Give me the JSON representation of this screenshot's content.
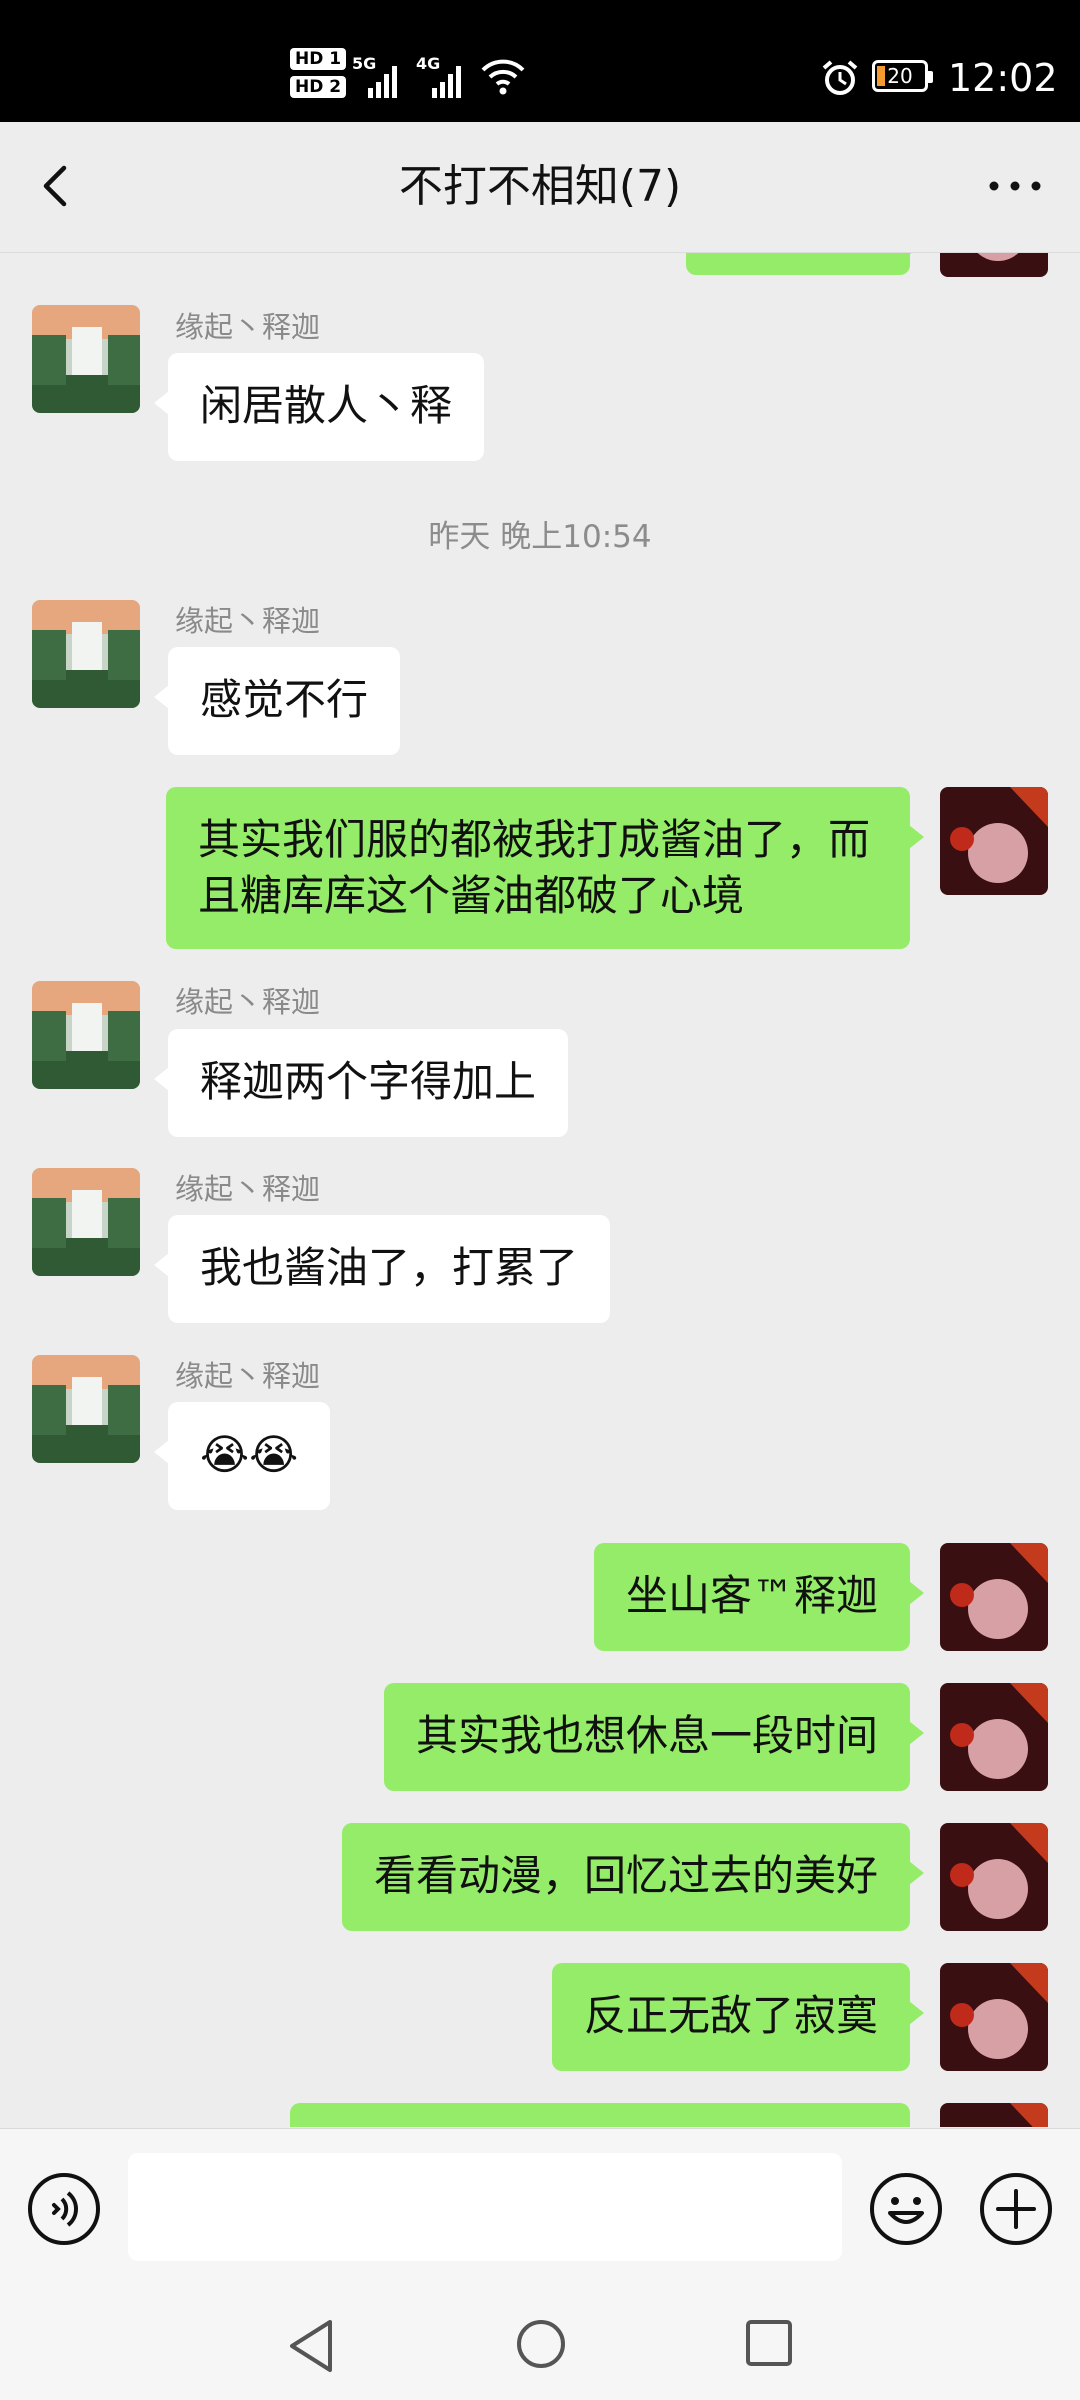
{
  "status_bar": {
    "hd1": "HD 1",
    "hd2": "HD 2",
    "net1": "5G",
    "net2": "4G",
    "battery": "20",
    "time": "12:02"
  },
  "header": {
    "title": "不打不相知(7)"
  },
  "messages": [
    {
      "side": "left",
      "sender": "缘起丶释迦",
      "text": "闲居散人丶释"
    },
    {
      "type": "time",
      "text": "昨天 晚上10:54"
    },
    {
      "side": "left",
      "sender": "缘起丶释迦",
      "text": "感觉不行"
    },
    {
      "side": "right",
      "text": "其实我们服的都被我打成酱油了，而且糖库库这个酱油都破了心境"
    },
    {
      "side": "left",
      "sender": "缘起丶释迦",
      "text": "释迦两个字得加上"
    },
    {
      "side": "left",
      "sender": "缘起丶释迦",
      "text": "我也酱油了，打累了"
    },
    {
      "side": "left",
      "sender": "缘起丶释迦",
      "text": "😭😭"
    },
    {
      "side": "right",
      "text": "坐山客™释迦"
    },
    {
      "side": "right",
      "text": "其实我也想休息一段时间"
    },
    {
      "side": "right",
      "text": "看看动漫，回忆过去的美好"
    },
    {
      "side": "right",
      "text": "反正无敌了寂寞"
    }
  ],
  "input": {
    "value": ""
  },
  "colors": {
    "bg": "#ededed",
    "bubble_self": "#95ec69",
    "bubble_other": "#ffffff"
  },
  "icons": {
    "back": "chevron-left-icon",
    "more": "more-dots-icon",
    "voice": "voice-icon",
    "emoji": "emoji-icon",
    "plus": "plus-icon"
  }
}
